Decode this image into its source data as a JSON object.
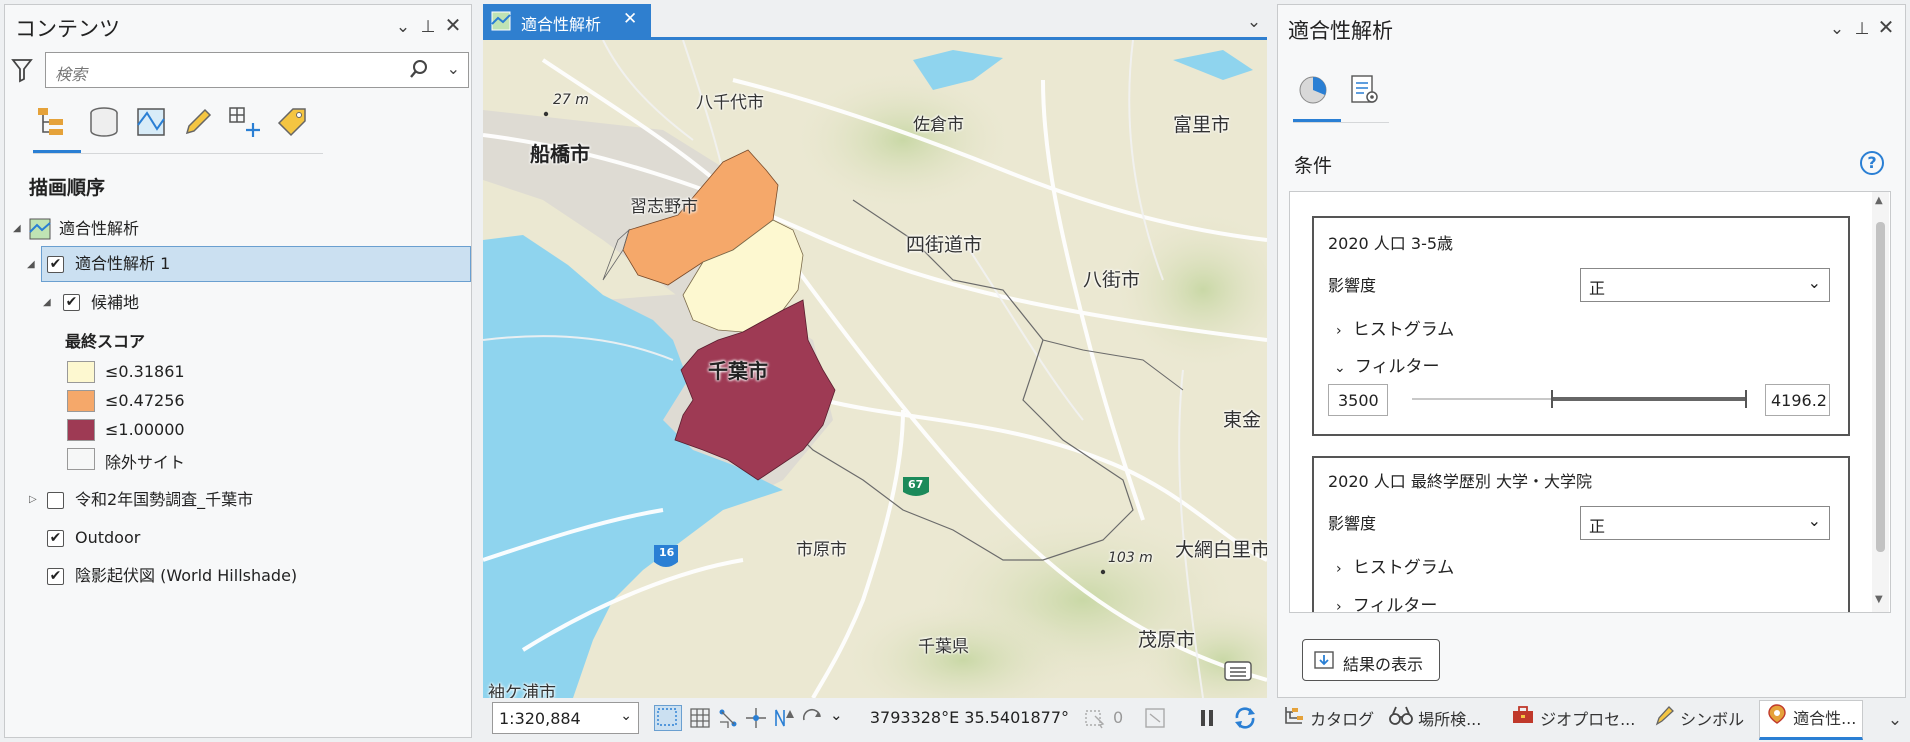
{
  "contents_pane": {
    "title": "コンテンツ",
    "search_placeholder": "検索",
    "section_title": "描画順序",
    "tree": {
      "map": "適合性解析",
      "layer": "適合性解析 1",
      "sublayer": "候補地",
      "legend_title": "最終スコア",
      "legend": [
        {
          "label": "≤0.31861",
          "color": "#fdf8d0"
        },
        {
          "label": "≤0.47256",
          "color": "#f5a86a"
        },
        {
          "label": "≤1.00000",
          "color": "#9e3a54"
        },
        {
          "label": "除外サイト",
          "color": "#f6f7f7"
        }
      ],
      "layer2": "令和2年国勢調査_千葉市",
      "layer3": "Outdoor",
      "layer4": "陰影起伏図 (World Hillshade)"
    }
  },
  "map_view": {
    "tab_title": "適合性解析",
    "scale": "1:320,884",
    "coords": "3793328°E 35.5401877°",
    "selected_count": "0",
    "labels": {
      "funabashi": "船橋市",
      "yachiyo": "八千代市",
      "sakura": "佐倉市",
      "tomisato": "富里市",
      "narashino": "習志野市",
      "yotsukaido": "四街道市",
      "yachimata": "八街市",
      "chiba": "千葉市",
      "togane": "東金",
      "ichihara": "市原市",
      "oamishirasato": "大網白里市",
      "chiba_pref": "千葉県",
      "mobara": "茂原市",
      "sodegaura": "袖ケ浦市",
      "elev1": "27 m",
      "elev2": "103 m",
      "route67": "67",
      "route16": "16"
    }
  },
  "suitability_pane": {
    "title": "適合性解析",
    "section": "条件",
    "criteria": [
      {
        "name": "2020 人口 3-5歳",
        "influence_label": "影響度",
        "influence_value": "正",
        "histogram": "ヒストグラム",
        "filter": "フィルター",
        "filter_min": "3500",
        "filter_max": "4196.2"
      },
      {
        "name": "2020 人口 最終学歴別 大学・大学院",
        "influence_label": "影響度",
        "influence_value": "正",
        "histogram": "ヒストグラム",
        "filter": "フィルター"
      }
    ],
    "show_results": "結果の表示"
  },
  "bottom_tabs": [
    "カタログ",
    "場所検...",
    "ジオプロセ...",
    "シンボル",
    "適合性..."
  ]
}
